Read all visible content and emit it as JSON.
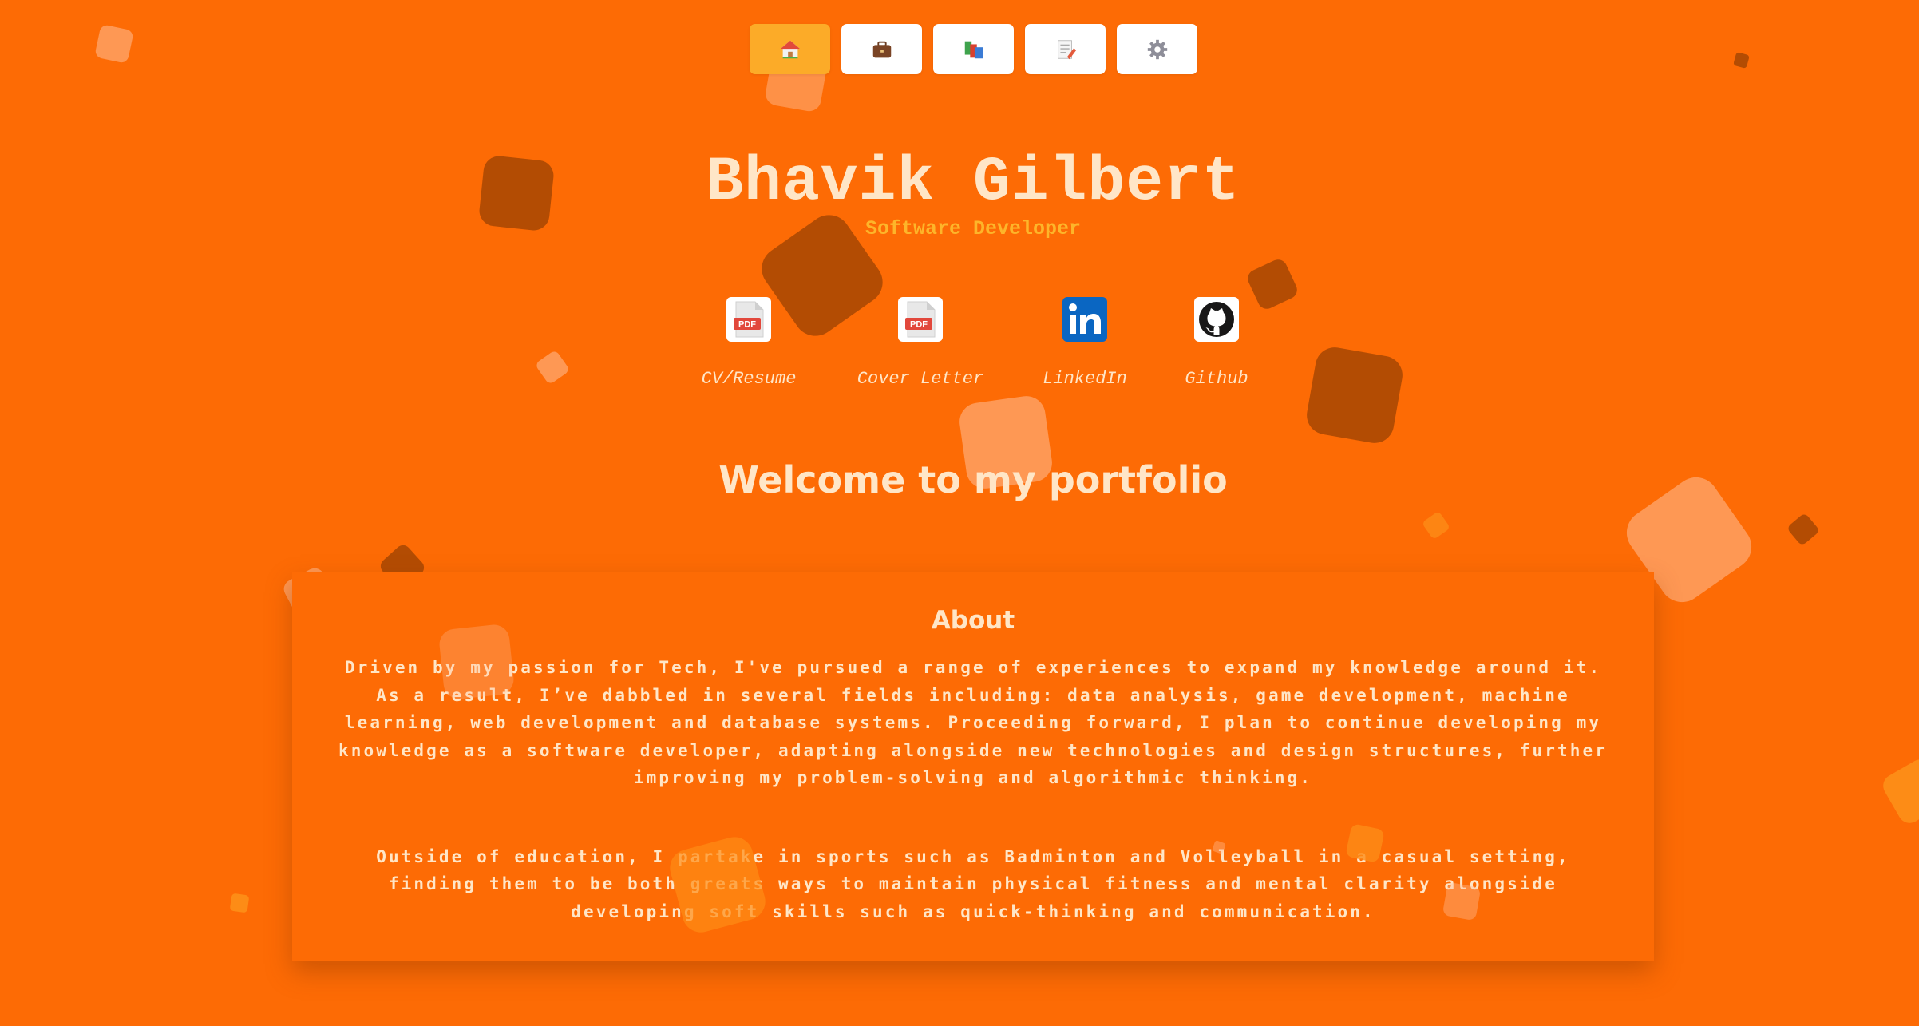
{
  "nav": {
    "items": [
      {
        "icon": "house-icon",
        "active": true
      },
      {
        "icon": "briefcase-icon",
        "active": false
      },
      {
        "icon": "books-icon",
        "active": false
      },
      {
        "icon": "memo-icon",
        "active": false
      },
      {
        "icon": "gear-icon",
        "active": false
      }
    ]
  },
  "header": {
    "name": "Bhavik Gilbert",
    "role": "Software Developer"
  },
  "links": [
    {
      "label": "CV/Resume",
      "icon": "pdf-icon"
    },
    {
      "label": "Cover Letter",
      "icon": "pdf-icon"
    },
    {
      "label": "LinkedIn",
      "icon": "linkedin-icon"
    },
    {
      "label": "Github",
      "icon": "github-icon"
    }
  ],
  "welcome": "Welcome to my portfolio",
  "about": {
    "title": "About",
    "paragraph1": "Driven by my passion for Tech, I've pursued a range of experiences to expand my knowledge around it. As a result, I’ve dabbled in several fields including: data analysis, game development, machine learning, web development and database systems. Proceeding forward, I plan to continue developing my knowledge as a software developer, adapting alongside new technologies and design structures, further improving my problem-solving and algorithmic thinking.",
    "paragraph2": "Outside of education, I partake in sports such as Badminton and Volleyball in a casual setting, finding them to be both greats ways to maintain physical fitness and mental clarity alongside developing soft skills such as quick-thinking and communication."
  },
  "colors": {
    "background": "#fd6b05",
    "text": "#ffe6c7",
    "accent": "#fcab28",
    "subtitle": "#fdb52a"
  }
}
